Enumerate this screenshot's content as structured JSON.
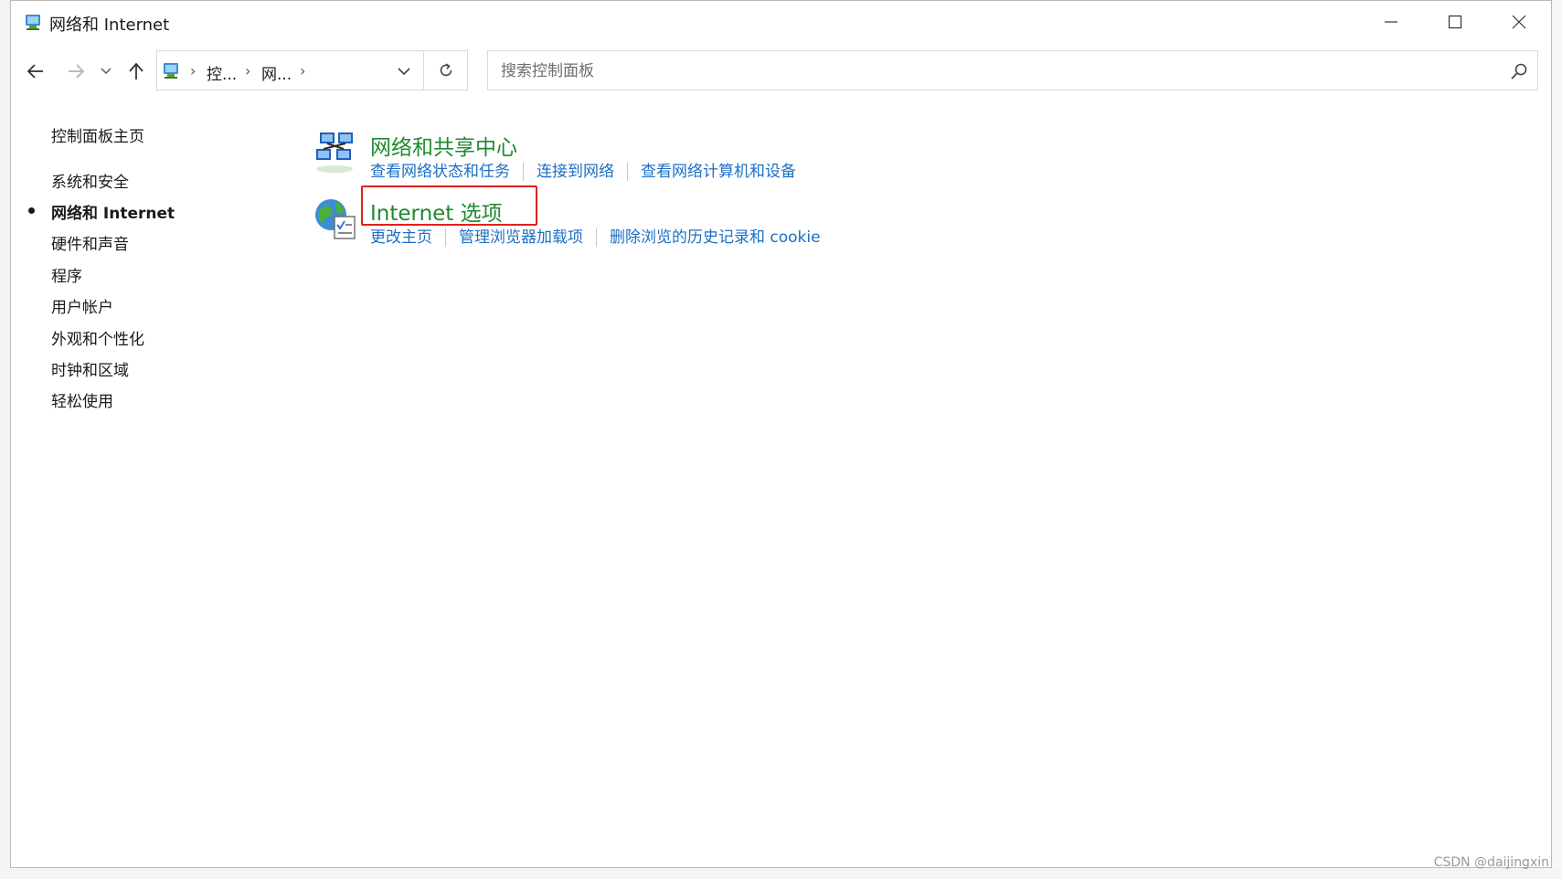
{
  "window": {
    "title": "网络和 Internet"
  },
  "address_bar": {
    "crumbs": [
      "控...",
      "网..."
    ],
    "separator": "›"
  },
  "search": {
    "placeholder": "搜索控制面板",
    "value": ""
  },
  "sidebar": {
    "home": "控制面板主页",
    "items": [
      {
        "label": "系统和安全",
        "active": false
      },
      {
        "label": "网络和 Internet",
        "active": true
      },
      {
        "label": "硬件和声音",
        "active": false
      },
      {
        "label": "程序",
        "active": false
      },
      {
        "label": "用户帐户",
        "active": false
      },
      {
        "label": "外观和个性化",
        "active": false
      },
      {
        "label": "时钟和区域",
        "active": false
      },
      {
        "label": "轻松使用",
        "active": false
      }
    ]
  },
  "categories": [
    {
      "title": "网络和共享中心",
      "icon": "network-sharing-center-icon",
      "links": [
        "查看网络状态和任务",
        "连接到网络",
        "查看网络计算机和设备"
      ]
    },
    {
      "title": "Internet 选项",
      "icon": "internet-options-globe-icon",
      "links": [
        "更改主页",
        "管理浏览器加载项",
        "删除浏览的历史记录和 cookie"
      ],
      "highlighted": true
    }
  ],
  "colors": {
    "category_title": "#1e8a2f",
    "link": "#1c6fc4",
    "highlight": "#e0201f"
  },
  "watermark": "CSDN @daijingxin"
}
